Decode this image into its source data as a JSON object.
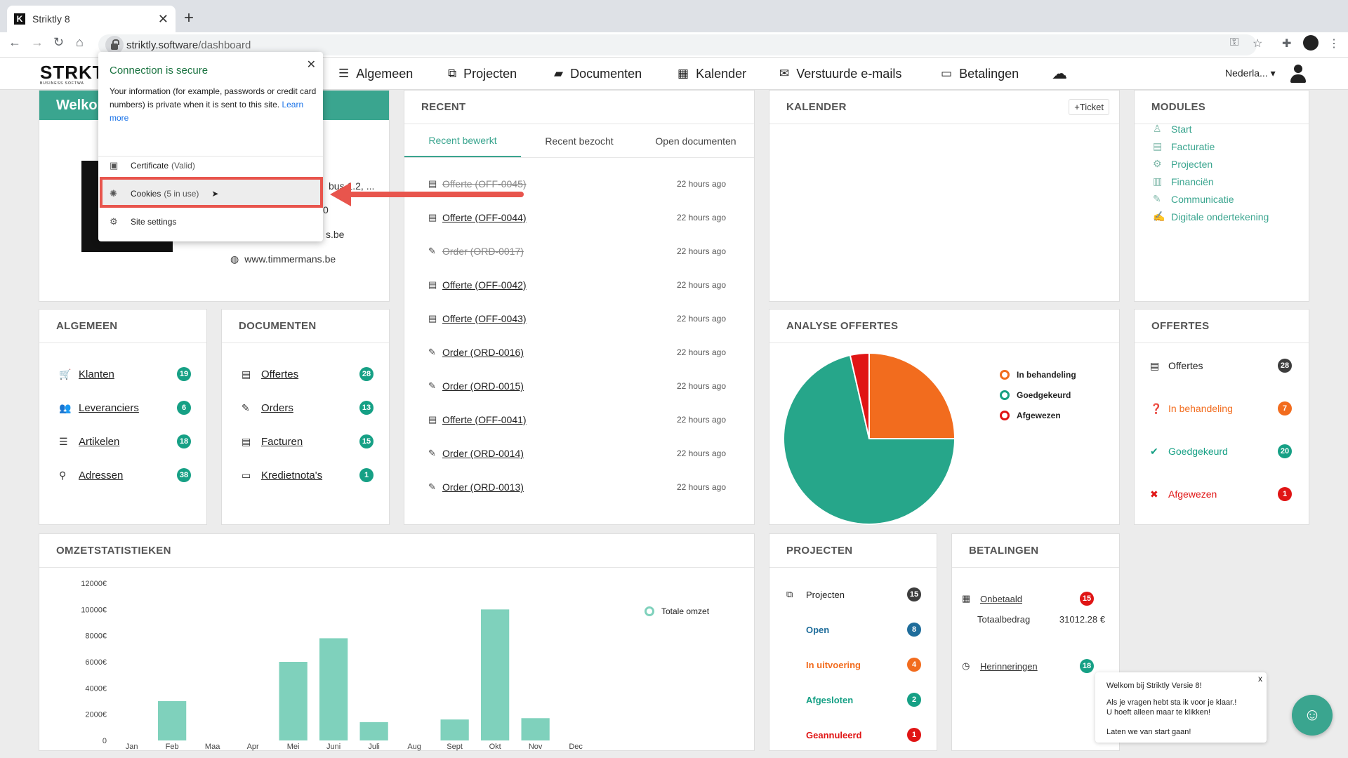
{
  "browser": {
    "tab_title": "Striktly 8",
    "tab_favicon": "K",
    "new_tab": "+",
    "url_host": "striktly.software",
    "url_path": "/dashboard"
  },
  "header": {
    "logo": "STRKTL",
    "logo_sub": "BUSINESS SOFTWA",
    "nav": [
      {
        "label": "Algemeen",
        "icon": "database-icon"
      },
      {
        "label": "Projecten",
        "icon": "sitemap-icon"
      },
      {
        "label": "Documenten",
        "icon": "folder-icon"
      },
      {
        "label": "Kalender",
        "icon": "calendar-icon"
      },
      {
        "label": "Verstuurde e-mails",
        "icon": "envelope-icon"
      },
      {
        "label": "Betalingen",
        "icon": "credit-card-icon"
      }
    ],
    "language": "Nederla..."
  },
  "security_popup": {
    "title": "Connection is secure",
    "text": "Your information (for example, passwords or credit card numbers) is private when it is sent to this site.",
    "learn_more": "Learn more",
    "certificate": "Certificate",
    "certificate_state": "(Valid)",
    "cookies": "Cookies",
    "cookies_state": "(5 in use)",
    "site_settings": "Site settings"
  },
  "welcome": {
    "banner": "Welkom",
    "address": "bus 1.2, ...",
    "line2": "0",
    "email": "s.be",
    "website": "www.timmermans.be"
  },
  "recent": {
    "title": "RECENT",
    "tabs": [
      "Recent bewerkt",
      "Recent bezocht",
      "Open documenten"
    ],
    "items": [
      {
        "label": "Offerte (OFF-0045)",
        "time": "22 hours ago",
        "strike": true
      },
      {
        "label": "Offerte (OFF-0044)",
        "time": "22 hours ago",
        "strike": false
      },
      {
        "label": "Order (ORD-0017)",
        "time": "22 hours ago",
        "strike": true
      },
      {
        "label": "Offerte (OFF-0042)",
        "time": "22 hours ago",
        "strike": false
      },
      {
        "label": "Offerte (OFF-0043)",
        "time": "22 hours ago",
        "strike": false
      },
      {
        "label": "Order (ORD-0016)",
        "time": "22 hours ago",
        "strike": false
      },
      {
        "label": "Order (ORD-0015)",
        "time": "22 hours ago",
        "strike": false
      },
      {
        "label": "Offerte (OFF-0041)",
        "time": "22 hours ago",
        "strike": false
      },
      {
        "label": "Order (ORD-0014)",
        "time": "22 hours ago",
        "strike": false
      },
      {
        "label": "Order (ORD-0013)",
        "time": "22 hours ago",
        "strike": false
      }
    ]
  },
  "kalender": {
    "title": "KALENDER",
    "ticket": "Ticket"
  },
  "modules": {
    "title": "MODULES",
    "items": [
      "Start",
      "Facturatie",
      "Projecten",
      "Financiën",
      "Communicatie",
      "Digitale ondertekening"
    ]
  },
  "algemeen": {
    "title": "ALGEMEEN",
    "items": [
      {
        "label": "Klanten",
        "count": "19"
      },
      {
        "label": "Leveranciers",
        "count": "6"
      },
      {
        "label": "Artikelen",
        "count": "18"
      },
      {
        "label": "Adressen",
        "count": "38"
      }
    ]
  },
  "documenten": {
    "title": "DOCUMENTEN",
    "items": [
      {
        "label": "Offertes",
        "count": "28"
      },
      {
        "label": "Orders",
        "count": "13"
      },
      {
        "label": "Facturen",
        "count": "15"
      },
      {
        "label": "Kredietnota's",
        "count": "1"
      }
    ]
  },
  "analyse": {
    "title": "ANALYSE OFFERTES",
    "legend": [
      {
        "label": "In behandeling",
        "color": "#f26c1e"
      },
      {
        "label": "Goedgekeurd",
        "color": "#16a085"
      },
      {
        "label": "Afgewezen",
        "color": "#e01515"
      }
    ]
  },
  "chart_data": {
    "type": "pie",
    "categories": [
      "In behandeling",
      "Goedgekeurd",
      "Afgewezen"
    ],
    "values": [
      7,
      20,
      1
    ],
    "colors": [
      "#f26c1e",
      "#26a68a",
      "#e01515"
    ]
  },
  "offertes": {
    "title": "OFFERTES",
    "items": [
      {
        "label": "Offertes",
        "count": "28",
        "color": "#222"
      },
      {
        "label": "In behandeling",
        "count": "7",
        "color": "#f26c1e"
      },
      {
        "label": "Goedgekeurd",
        "count": "20",
        "color": "#16a085"
      },
      {
        "label": "Afgewezen",
        "count": "1",
        "color": "#e01515"
      }
    ]
  },
  "omzet": {
    "title": "OMZETSTATISTIEKEN",
    "legend": "Totale omzet",
    "months": [
      "Jan",
      "Feb",
      "Maa",
      "Apr",
      "Mei",
      "Juni",
      "Juli",
      "Aug",
      "Sept",
      "Okt",
      "Nov",
      "Dec"
    ],
    "values": [
      0,
      3000,
      0,
      0,
      6000,
      7800,
      1400,
      0,
      1600,
      10000,
      1700,
      0
    ],
    "y_ticks": [
      "0",
      "2000€",
      "4000€",
      "6000€",
      "8000€",
      "10000€",
      "12000€"
    ],
    "ylim": [
      0,
      12000
    ],
    "color": "#7fd1bc"
  },
  "projecten": {
    "title": "PROJECTEN",
    "items": [
      {
        "label": "Projecten",
        "count": "15",
        "color": "#222"
      },
      {
        "label": "Open",
        "count": "8",
        "color": "#1f6d9b"
      },
      {
        "label": "In uitvoering",
        "count": "4",
        "color": "#f26c1e"
      },
      {
        "label": "Afgesloten",
        "count": "2",
        "color": "#16a085"
      },
      {
        "label": "Geannuleerd",
        "count": "1",
        "color": "#e01515"
      }
    ]
  },
  "betalingen": {
    "title": "BETALINGEN",
    "onbetaald": "Onbetaald",
    "onbetaald_count": "15",
    "totaal_label": "Totaalbedrag",
    "totaal_value": "31012.28 €",
    "herinneringen": "Herinneringen",
    "herinneringen_count": "18"
  },
  "chat": {
    "line1": "Welkom bij Striktly Versie 8!",
    "line2": "Als je vragen hebt sta ik voor je klaar.!",
    "line3": "U hoeft alleen maar te klikken!",
    "line4": "Laten we van start gaan!",
    "close": "x"
  }
}
